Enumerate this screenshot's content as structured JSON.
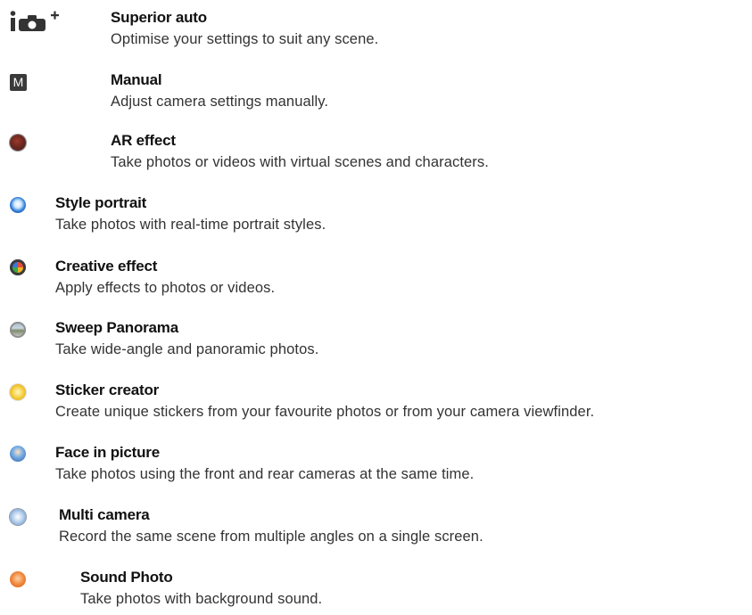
{
  "modes": [
    {
      "title": "Superior auto",
      "description": "Optimise your settings to suit any scene.",
      "icon": "superior-auto-icon"
    },
    {
      "title": "Manual",
      "description": "Adjust camera settings manually.",
      "icon": "manual-m-icon"
    },
    {
      "title": "AR effect",
      "description": "Take photos or videos with virtual scenes and characters.",
      "icon": "ar-effect-icon"
    },
    {
      "title": "Style portrait",
      "description": "Take photos with real-time portrait styles.",
      "icon": "style-portrait-icon"
    },
    {
      "title": "Creative effect",
      "description": "Apply effects to photos or videos.",
      "icon": "creative-effect-icon"
    },
    {
      "title": "Sweep Panorama",
      "description": "Take wide-angle and panoramic photos.",
      "icon": "sweep-panorama-icon"
    },
    {
      "title": "Sticker creator",
      "description": "Create unique stickers from your favourite photos or from your camera viewfinder.",
      "icon": "sticker-creator-icon"
    },
    {
      "title": "Face in picture",
      "description": "Take photos using the front and rear cameras at the same time.",
      "icon": "face-in-picture-icon"
    },
    {
      "title": "Multi camera",
      "description": "Record the same scene from multiple angles on a single screen.",
      "icon": "multi-camera-icon"
    },
    {
      "title": "Sound Photo",
      "description": "Take photos with background sound.",
      "icon": "sound-photo-icon"
    }
  ],
  "icon_labels": {
    "manual": "M",
    "superior_auto": "i",
    "superior_auto_plus": "+"
  }
}
